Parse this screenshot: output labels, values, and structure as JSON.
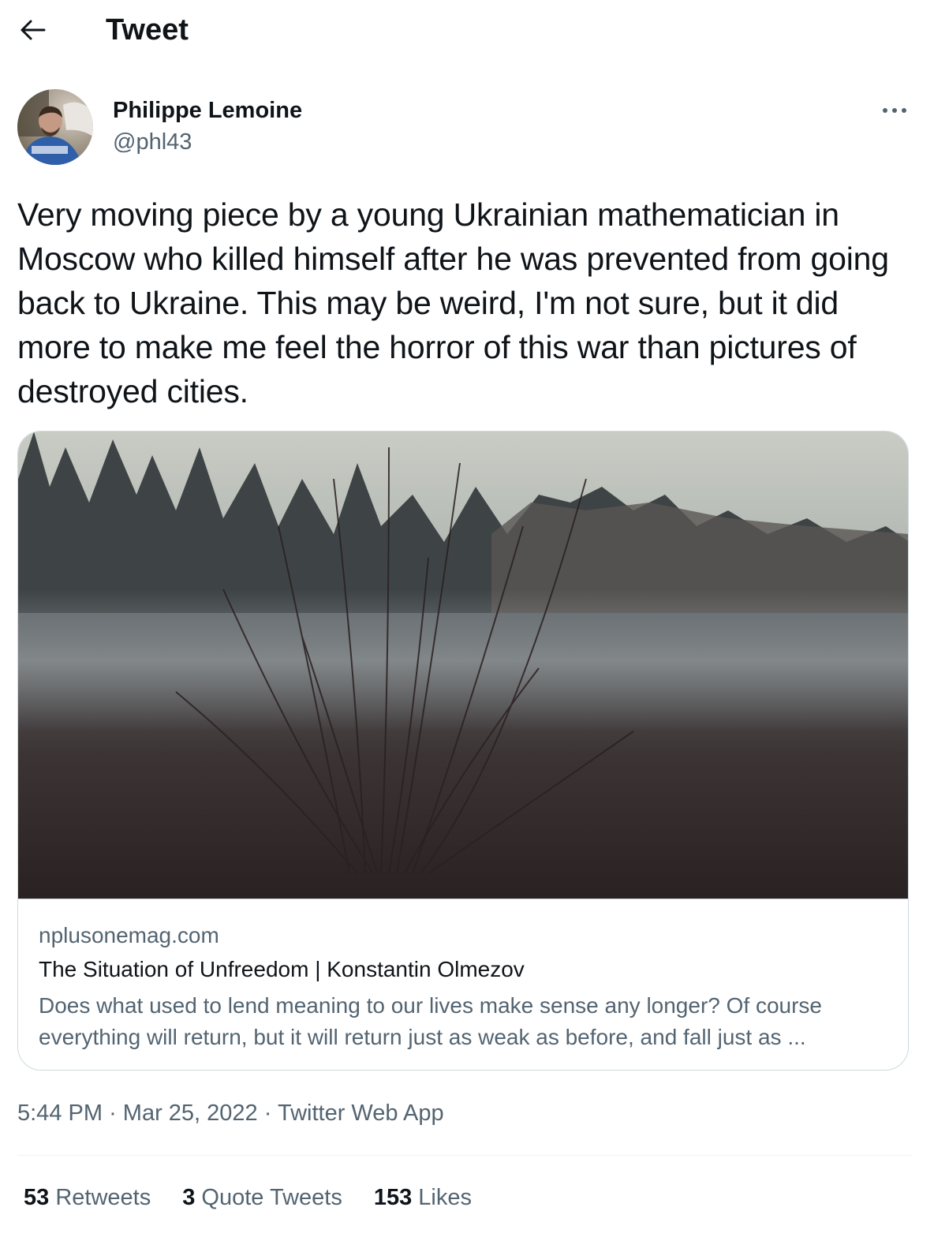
{
  "header": {
    "title": "Tweet",
    "back_icon": "arrow-left-icon"
  },
  "author": {
    "name": "Philippe Lemoine",
    "handle": "@phl43",
    "more_icon": "more-horizontal-icon"
  },
  "tweet": {
    "text": "Very moving piece by a young Ukrainian mathematician in Moscow who killed himself after he was prevented from going back to Ukraine. This may be weird, I'm not sure, but it did more to make me feel the horror of this war than pictures of destroyed cities."
  },
  "card": {
    "domain": "nplusonemag.com",
    "title": "The Situation of Unfreedom | Konstantin Olmezov",
    "description_line1": "Does what used to lend meaning to our lives make sense any longer? Of course",
    "description_line2": "everything will return, but it will return just as weak as before, and fall just as ..."
  },
  "meta": {
    "time": "5:44 PM",
    "separator": "·",
    "date": "Mar 25, 2022",
    "source": "Twitter Web App"
  },
  "stats": {
    "retweets_count": "53",
    "retweets_label": "Retweets",
    "quotes_count": "3",
    "quotes_label": "Quote Tweets",
    "likes_count": "153",
    "likes_label": "Likes"
  }
}
